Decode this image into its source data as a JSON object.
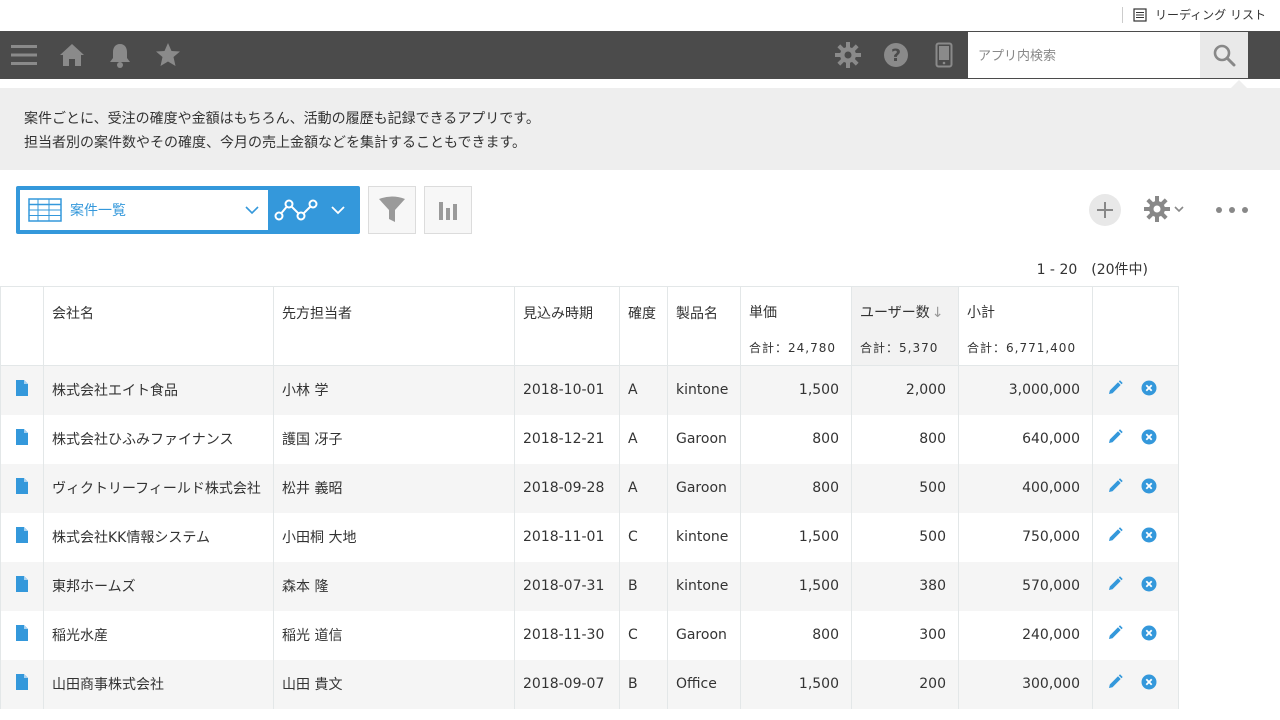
{
  "header": {
    "reading_list": "リーディング リスト"
  },
  "search": {
    "placeholder": "アプリ内検索"
  },
  "description": {
    "line1": "案件ごとに、受注の確度や金額はもちろん、活動の履歴も記録できるアプリです。",
    "line2": "担当者別の案件数やその確度、今月の売上金額などを集計することもできます。"
  },
  "view": {
    "selected": "案件一覧"
  },
  "pager": {
    "text": "1 - 20　(20件中)"
  },
  "table": {
    "columns": {
      "company": "会社名",
      "contact": "先方担当者",
      "date": "見込み時期",
      "certainty": "確度",
      "product": "製品名",
      "price": "単価",
      "users": "ユーザー数",
      "subtotal": "小計"
    },
    "sort_indicator": "↓",
    "sums": {
      "price": "合計：24,780",
      "users": "合計：5,370",
      "subtotal": "合計：6,771,400"
    },
    "rows": [
      {
        "company": "株式会社エイト食品",
        "contact": "小林 学",
        "date": "2018-10-01",
        "certainty": "A",
        "product": "kintone",
        "price": "1,500",
        "users": "2,000",
        "subtotal": "3,000,000"
      },
      {
        "company": "株式会社ひふみファイナンス",
        "contact": "護国 冴子",
        "date": "2018-12-21",
        "certainty": "A",
        "product": "Garoon",
        "price": "800",
        "users": "800",
        "subtotal": "640,000"
      },
      {
        "company": "ヴィクトリーフィールド株式会社",
        "contact": "松井 義昭",
        "date": "2018-09-28",
        "certainty": "A",
        "product": "Garoon",
        "price": "800",
        "users": "500",
        "subtotal": "400,000"
      },
      {
        "company": "株式会社KK情報システム",
        "contact": "小田桐 大地",
        "date": "2018-11-01",
        "certainty": "C",
        "product": "kintone",
        "price": "1,500",
        "users": "500",
        "subtotal": "750,000"
      },
      {
        "company": "東邦ホームズ",
        "contact": "森本 隆",
        "date": "2018-07-31",
        "certainty": "B",
        "product": "kintone",
        "price": "1,500",
        "users": "380",
        "subtotal": "570,000"
      },
      {
        "company": "稲光水産",
        "contact": "稲光 道信",
        "date": "2018-11-30",
        "certainty": "C",
        "product": "Garoon",
        "price": "800",
        "users": "300",
        "subtotal": "240,000"
      },
      {
        "company": "山田商事株式会社",
        "contact": "山田 貴文",
        "date": "2018-09-07",
        "certainty": "B",
        "product": "Office",
        "price": "1,500",
        "users": "200",
        "subtotal": "300,000"
      }
    ]
  },
  "colors": {
    "accent": "#3498db",
    "navbar": "#4b4b4b",
    "icon_gray": "#9a9a9a"
  }
}
